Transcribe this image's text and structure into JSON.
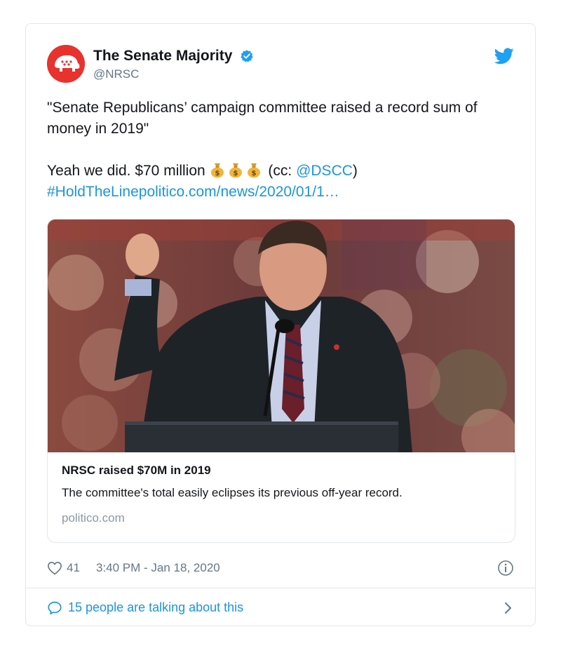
{
  "author": {
    "display_name": "The Senate Majority",
    "handle": "@NRSC",
    "verified": true,
    "avatar_icon": "elephant-logo-icon",
    "avatar_color": "#e8322e"
  },
  "tweet": {
    "quote_line": "\"Senate Republicans’ campaign committee raised a record sum of money in 2019\"",
    "body_prefix": "Yeah we did. $70 million",
    "emoji_icon": "money-bag-icon",
    "emoji_count": 3,
    "cc_open": "(cc: ",
    "mention": "@DSCC",
    "cc_close": ")",
    "hashtag": "#HoldTheLine",
    "url": "politico.com/news/2020/01/1…"
  },
  "link_card": {
    "title": "NRSC raised $70M in 2019",
    "description": "The committee's total easily eclipses its previous off-year record.",
    "domain": "politico.com"
  },
  "meta": {
    "like_count": "41",
    "timestamp": "3:40 PM - Jan 18, 2020"
  },
  "footer": {
    "talking_text": "15 people are talking about this"
  },
  "colors": {
    "link": "#1b95e0",
    "text": "#14171a",
    "muted": "#657786",
    "border": "#e1e8ed"
  }
}
